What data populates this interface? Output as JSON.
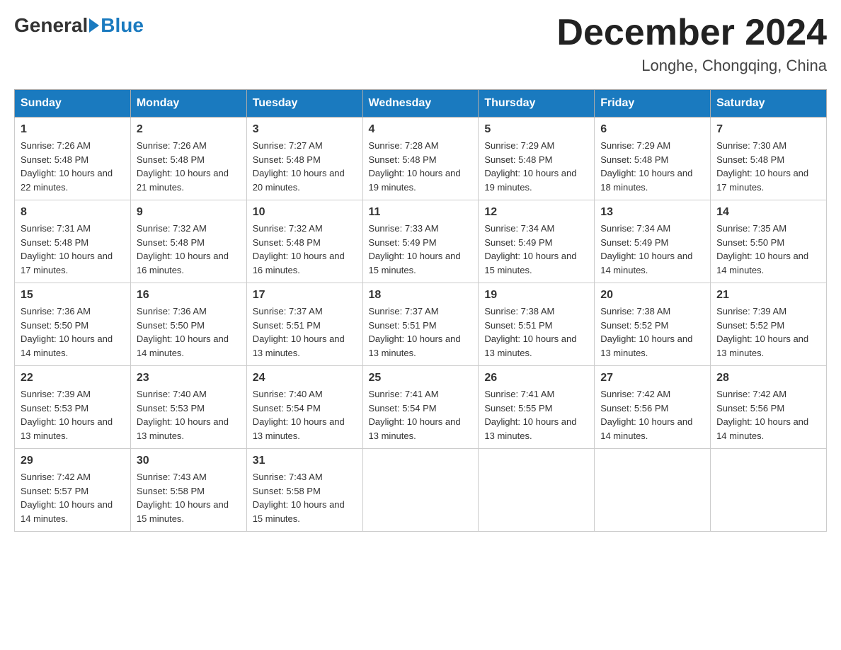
{
  "header": {
    "logo": {
      "general": "General",
      "blue": "Blue"
    },
    "title": "December 2024",
    "location": "Longhe, Chongqing, China"
  },
  "days_of_week": [
    "Sunday",
    "Monday",
    "Tuesday",
    "Wednesday",
    "Thursday",
    "Friday",
    "Saturday"
  ],
  "weeks": [
    [
      {
        "day": "1",
        "sunrise": "7:26 AM",
        "sunset": "5:48 PM",
        "daylight": "10 hours and 22 minutes."
      },
      {
        "day": "2",
        "sunrise": "7:26 AM",
        "sunset": "5:48 PM",
        "daylight": "10 hours and 21 minutes."
      },
      {
        "day": "3",
        "sunrise": "7:27 AM",
        "sunset": "5:48 PM",
        "daylight": "10 hours and 20 minutes."
      },
      {
        "day": "4",
        "sunrise": "7:28 AM",
        "sunset": "5:48 PM",
        "daylight": "10 hours and 19 minutes."
      },
      {
        "day": "5",
        "sunrise": "7:29 AM",
        "sunset": "5:48 PM",
        "daylight": "10 hours and 19 minutes."
      },
      {
        "day": "6",
        "sunrise": "7:29 AM",
        "sunset": "5:48 PM",
        "daylight": "10 hours and 18 minutes."
      },
      {
        "day": "7",
        "sunrise": "7:30 AM",
        "sunset": "5:48 PM",
        "daylight": "10 hours and 17 minutes."
      }
    ],
    [
      {
        "day": "8",
        "sunrise": "7:31 AM",
        "sunset": "5:48 PM",
        "daylight": "10 hours and 17 minutes."
      },
      {
        "day": "9",
        "sunrise": "7:32 AM",
        "sunset": "5:48 PM",
        "daylight": "10 hours and 16 minutes."
      },
      {
        "day": "10",
        "sunrise": "7:32 AM",
        "sunset": "5:48 PM",
        "daylight": "10 hours and 16 minutes."
      },
      {
        "day": "11",
        "sunrise": "7:33 AM",
        "sunset": "5:49 PM",
        "daylight": "10 hours and 15 minutes."
      },
      {
        "day": "12",
        "sunrise": "7:34 AM",
        "sunset": "5:49 PM",
        "daylight": "10 hours and 15 minutes."
      },
      {
        "day": "13",
        "sunrise": "7:34 AM",
        "sunset": "5:49 PM",
        "daylight": "10 hours and 14 minutes."
      },
      {
        "day": "14",
        "sunrise": "7:35 AM",
        "sunset": "5:50 PM",
        "daylight": "10 hours and 14 minutes."
      }
    ],
    [
      {
        "day": "15",
        "sunrise": "7:36 AM",
        "sunset": "5:50 PM",
        "daylight": "10 hours and 14 minutes."
      },
      {
        "day": "16",
        "sunrise": "7:36 AM",
        "sunset": "5:50 PM",
        "daylight": "10 hours and 14 minutes."
      },
      {
        "day": "17",
        "sunrise": "7:37 AM",
        "sunset": "5:51 PM",
        "daylight": "10 hours and 13 minutes."
      },
      {
        "day": "18",
        "sunrise": "7:37 AM",
        "sunset": "5:51 PM",
        "daylight": "10 hours and 13 minutes."
      },
      {
        "day": "19",
        "sunrise": "7:38 AM",
        "sunset": "5:51 PM",
        "daylight": "10 hours and 13 minutes."
      },
      {
        "day": "20",
        "sunrise": "7:38 AM",
        "sunset": "5:52 PM",
        "daylight": "10 hours and 13 minutes."
      },
      {
        "day": "21",
        "sunrise": "7:39 AM",
        "sunset": "5:52 PM",
        "daylight": "10 hours and 13 minutes."
      }
    ],
    [
      {
        "day": "22",
        "sunrise": "7:39 AM",
        "sunset": "5:53 PM",
        "daylight": "10 hours and 13 minutes."
      },
      {
        "day": "23",
        "sunrise": "7:40 AM",
        "sunset": "5:53 PM",
        "daylight": "10 hours and 13 minutes."
      },
      {
        "day": "24",
        "sunrise": "7:40 AM",
        "sunset": "5:54 PM",
        "daylight": "10 hours and 13 minutes."
      },
      {
        "day": "25",
        "sunrise": "7:41 AM",
        "sunset": "5:54 PM",
        "daylight": "10 hours and 13 minutes."
      },
      {
        "day": "26",
        "sunrise": "7:41 AM",
        "sunset": "5:55 PM",
        "daylight": "10 hours and 13 minutes."
      },
      {
        "day": "27",
        "sunrise": "7:42 AM",
        "sunset": "5:56 PM",
        "daylight": "10 hours and 14 minutes."
      },
      {
        "day": "28",
        "sunrise": "7:42 AM",
        "sunset": "5:56 PM",
        "daylight": "10 hours and 14 minutes."
      }
    ],
    [
      {
        "day": "29",
        "sunrise": "7:42 AM",
        "sunset": "5:57 PM",
        "daylight": "10 hours and 14 minutes."
      },
      {
        "day": "30",
        "sunrise": "7:43 AM",
        "sunset": "5:58 PM",
        "daylight": "10 hours and 15 minutes."
      },
      {
        "day": "31",
        "sunrise": "7:43 AM",
        "sunset": "5:58 PM",
        "daylight": "10 hours and 15 minutes."
      },
      null,
      null,
      null,
      null
    ]
  ]
}
